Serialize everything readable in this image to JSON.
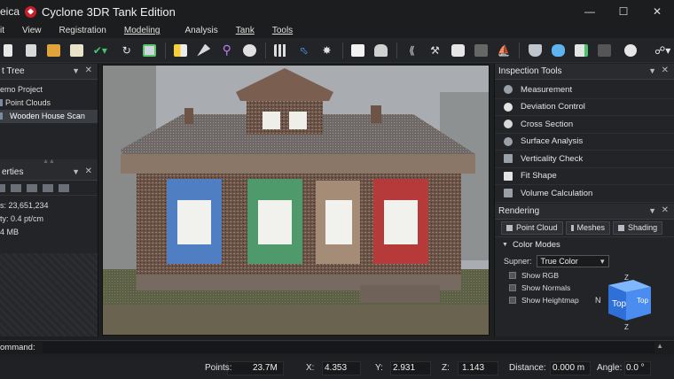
{
  "app": {
    "brand": "eica",
    "title": "Cyclone 3DR Tank Edition",
    "window_buttons": [
      "minimize",
      "maximize",
      "close"
    ]
  },
  "menu": [
    "it",
    "View",
    "Registration",
    "Modeling",
    "Analysis",
    "Tank",
    "Tools"
  ],
  "toolbar_icons": [
    "new-icon",
    "save-as-icon",
    "open-folder-icon",
    "report-icon",
    "select-arrow-icon",
    "undo-icon",
    "clone-icon",
    "layer-icon",
    "brush-icon",
    "search-icon",
    "inspect-icon",
    "grid-icon",
    "cursor-select-icon",
    "settings-icon",
    "box-icon",
    "hook-icon",
    "pin-icon",
    "probe-icon",
    "point-icon",
    "mesh-icon",
    "ship-icon",
    "surface-icon",
    "cloud-icon",
    "filter-icon",
    "sphere-icon",
    "export-icon"
  ],
  "left": {
    "tree_title": "t Tree",
    "tree": [
      {
        "label": "emo Project",
        "selected": false
      },
      {
        "label": "Point Clouds",
        "selected": false
      },
      {
        "label": "Wooden House Scan",
        "selected": true
      }
    ],
    "props_title": "erties",
    "props": [
      {
        "label": "s: 23,651,234"
      },
      {
        "label": "ty: 0.4 pt/cm"
      },
      {
        "label": "4 MB"
      }
    ]
  },
  "right": {
    "inspection_title": "Inspection Tools",
    "tools": [
      {
        "label": "Measurement",
        "icon": "ruler-icon"
      },
      {
        "label": "Deviation Control",
        "icon": "deviation-icon"
      },
      {
        "label": "Cross Section",
        "icon": "section-icon"
      },
      {
        "label": "Surface Analysis",
        "icon": "surface-analysis-icon"
      },
      {
        "label": "Verticality Check",
        "icon": "verticality-icon"
      },
      {
        "label": "Fit Shape",
        "icon": "fit-shape-icon"
      },
      {
        "label": "Volume Calculation",
        "icon": "volume-icon"
      }
    ],
    "rendering_title": "Rendering",
    "render_tabs": [
      "Point Cloud",
      "Meshes",
      "Shading"
    ],
    "color_modes_label": "Color Modes",
    "supner_label": "Supner:",
    "supner_value": "True Color",
    "checks": [
      "Show RGB",
      "Show Normals",
      "Show Heightmap"
    ],
    "cube": {
      "top": "Top",
      "front": "Top",
      "side": "Top",
      "axis_n": "N",
      "axis_z": "Z",
      "axis_z2": "Z"
    }
  },
  "command": {
    "label": "ommand:"
  },
  "status": {
    "points_label": "Points:",
    "points_value": "23.7M",
    "x_label": "X:",
    "x_value": "4.353",
    "y_label": "Y:",
    "y_value": "2.931",
    "z_label": "Z:",
    "z_value": "1.143",
    "distance_label": "Distance:",
    "distance_value": "0.000 m",
    "angle_label": "Angle:",
    "angle_value": "0.0 °"
  }
}
